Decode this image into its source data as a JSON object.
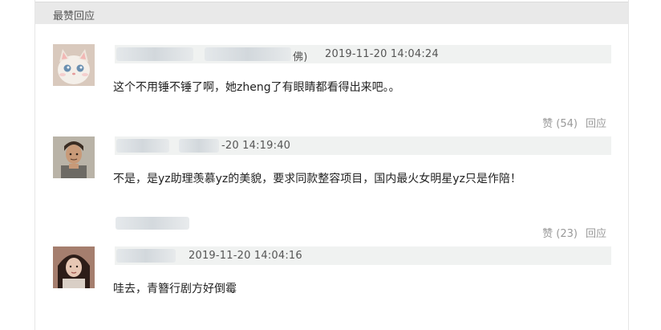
{
  "header": {
    "title": "最赞回应"
  },
  "comments": [
    {
      "meta_suffix": "佛)",
      "timestamp": "2019-11-20 14:04:24",
      "text": "这个不用锤不锤了啊，她zheng了有眼睛都看得出来吧。。",
      "like_label": "赞 (54)",
      "reply_label": "回应"
    },
    {
      "timestamp": "-20 14:19:40",
      "text": "不是，是yz助理羡慕yz的美貌，要求同款整容项目，国内最火女明星yz只是作陪！",
      "like_label": "赞 (23)",
      "reply_label": "回应"
    },
    {
      "timestamp": "2019-11-20 14:04:16",
      "text": "哇去，青簪行剧方好倒霉"
    }
  ]
}
